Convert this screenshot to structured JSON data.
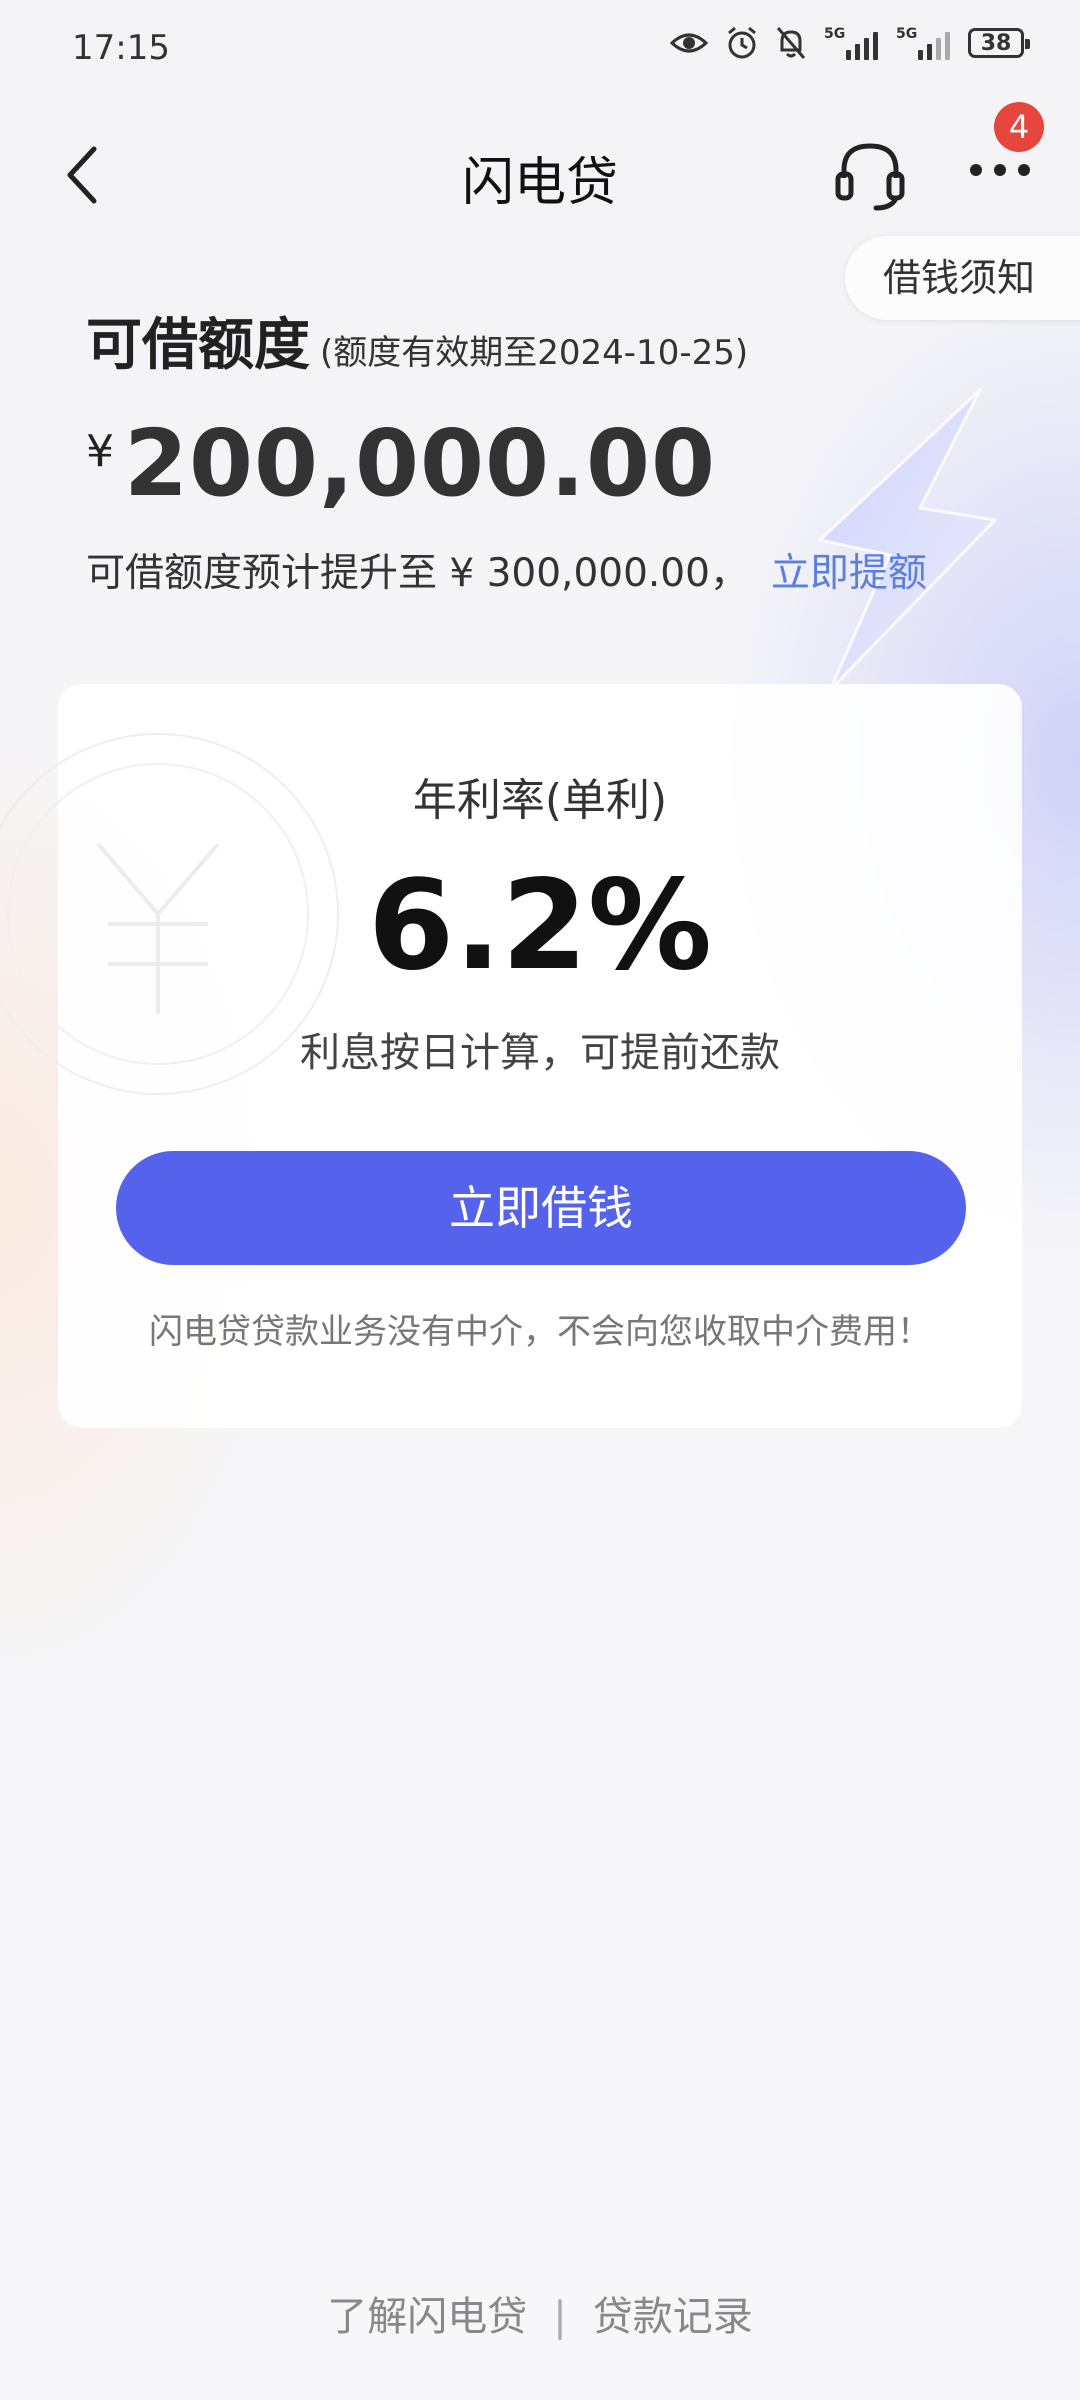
{
  "status_bar": {
    "time": "17:15",
    "network1_label": "5G",
    "network2_label": "5G",
    "battery": "38"
  },
  "header": {
    "title": "闪电贷",
    "badge_count": "4",
    "notice_label": "借钱须知"
  },
  "credit": {
    "title": "可借额度",
    "validity": "(额度有效期至2024-10-25)",
    "currency": "¥",
    "amount": "200,000.00",
    "raise_text": "可借额度预计提升至 ¥ 300,000.00，",
    "raise_link": "立即提额"
  },
  "rate_card": {
    "label": "年利率(单利)",
    "value": "6.2%",
    "note": "利息按日计算，可提前还款",
    "button": "立即借钱",
    "disclaimer": "闪电贷贷款业务没有中介，不会向您收取中介费用！"
  },
  "footer": {
    "learn_more": "了解闪电贷",
    "separator": "|",
    "records": "贷款记录"
  },
  "icons": [
    "eye-icon",
    "alarm-icon",
    "mute-icon",
    "signal-icon",
    "battery-icon",
    "back-icon",
    "headset-icon",
    "more-icon",
    "lightning-icon"
  ],
  "colors": {
    "primary_button": "#5563ec",
    "link": "#5b7fe0",
    "badge": "#e7463f"
  }
}
